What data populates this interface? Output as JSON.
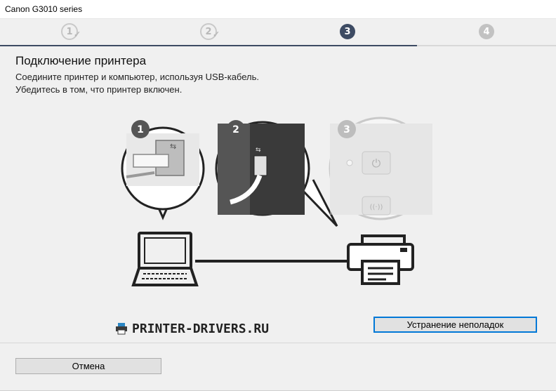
{
  "window": {
    "title": "Canon G3010 series"
  },
  "steps": [
    {
      "label": "1",
      "state": "done"
    },
    {
      "label": "2",
      "state": "done"
    },
    {
      "label": "3",
      "state": "active"
    },
    {
      "label": "4",
      "state": "future"
    }
  ],
  "content": {
    "heading": "Подключение принтера",
    "line1": "Соедините принтер и компьютер, используя USB-кабель.",
    "line2": "Убедитесь в том, что принтер включен."
  },
  "illustration": {
    "callouts": [
      "1",
      "2",
      "3"
    ]
  },
  "watermark": {
    "text": "PRINTER-DRIVERS.RU"
  },
  "buttons": {
    "troubleshoot": "Устранение неполадок",
    "cancel": "Отмена"
  },
  "colors": {
    "accent": "#3d4b63",
    "focus": "#0078d7"
  }
}
